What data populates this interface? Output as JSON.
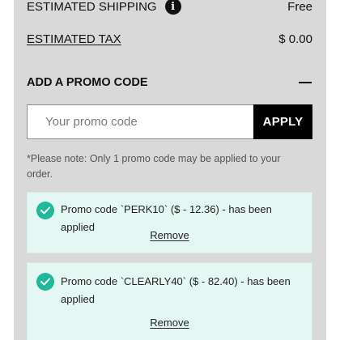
{
  "summary": {
    "shipping_label": "ESTIMATED SHIPPING",
    "shipping_value": "Free",
    "tax_label": "ESTIMATED TAX",
    "tax_value": "$ 0.00"
  },
  "promo": {
    "heading": "ADD A PROMO CODE",
    "placeholder": "Your promo code",
    "input_value": "",
    "apply_label": "APPLY",
    "note": "*Please note: Only 1 promo code may be applied to your order.",
    "applied": [
      {
        "message": "Promo code `PERK10` ($ - 12.36) - has been applied",
        "remove_label": "Remove"
      },
      {
        "message": "Promo code `CLEARLY40` ($ - 82.40) - has been applied",
        "remove_label": "Remove"
      }
    ]
  },
  "colors": {
    "panel_bg": "#d9d9d9",
    "applied_bg": "#e4f7f3",
    "check_green": "#21b79a",
    "apply_bg": "#000000"
  },
  "icons": [
    "info-icon",
    "collapse-icon",
    "check-icon"
  ]
}
